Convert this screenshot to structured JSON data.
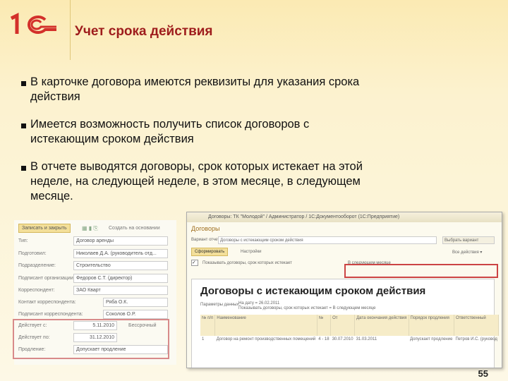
{
  "slide": {
    "title": "Учет срока действия",
    "page_number": "55",
    "logo_text": "1С",
    "accent": "#9e1c1c",
    "bullets": [
      "В карточке договора имеются реквизиты для указания срока действия",
      "Имеется возможность получить список договоров с истекающим сроком действия",
      "В отчете выводятся договоры, срок которых истекает на этой неделе, на следующей неделе, в этом месяце, в следующем месяце."
    ]
  },
  "card": {
    "save_close": "Записать и закрыть",
    "create_based": "Создать на основании",
    "rows": [
      {
        "label": "Тип:",
        "value": "Договор аренды"
      },
      {
        "label": "Подготовил:",
        "value": "Николаев Д.А. (руководитель отд..."
      },
      {
        "label": "Подразделение:",
        "value": "Строительство"
      },
      {
        "label": "Подписант организации:",
        "value": "Федоров С.Т. (директор)"
      },
      {
        "label": "Корреспондент:",
        "value": "ЗАО Кварт"
      },
      {
        "label": "Контакт корреспондента:",
        "value": "Ряба О.К."
      },
      {
        "label": "Подписант корреспондента:",
        "value": "Соколов О.Р."
      }
    ],
    "term_rows": [
      {
        "label": "Действует с:",
        "value": "5.11.2010"
      },
      {
        "label": "Действует по:",
        "value": "31.12.2010"
      },
      {
        "label": "Продление:",
        "value": "Допускает продление"
      }
    ],
    "indefinite": "Бессрочный"
  },
  "report": {
    "window_title": "Договоры: ТК \"Молодой\" / Администратор / 1С:Документооборот (1С:Предприятие)",
    "form_title": "Договоры",
    "variant_label": "Вариант отчета:",
    "variant_value": "Договоры с истекающим сроком действия",
    "choose_variant": "Выбрать вариант",
    "generate": "Сформировать",
    "settings": "Настройки",
    "all_actions": "Все действия ▾",
    "filter_label": "Показывать договоры, срок которых истекает",
    "filter_value": "В следующем месяце",
    "heading": "Договоры с истекающим сроком действия",
    "params_label": "Параметры данных:",
    "param1": "На дату = 26.02.2011",
    "param2": "Показывать договоры, срок которых истекает = В следующем месяце",
    "columns": [
      "№ п/п",
      "Наименование",
      "№",
      "От",
      "Дата окончания действия",
      "Порядок продления",
      "Ответственный"
    ],
    "rows": [
      [
        "1",
        "Договор на ремонт производственных помещений",
        "4 - 18",
        "30.07.2010",
        "31.03.2011",
        "Допускает продление",
        "Петров И.С. (руковод"
      ]
    ]
  }
}
